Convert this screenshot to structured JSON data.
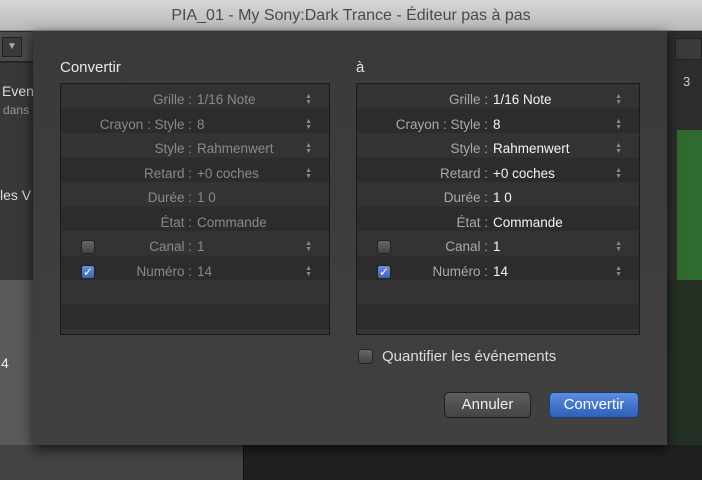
{
  "window": {
    "title": "PIA_01 - My Sony:Dark Trance - Éditeur pas à pas"
  },
  "background": {
    "dropdown_arrow": "▼",
    "event_label": "Even",
    "event_sub": "dans",
    "list_label": "les V",
    "number": "4",
    "ruler_number": "3"
  },
  "dialog": {
    "from_title": "Convertir",
    "to_title": "à",
    "from_rows": [
      {
        "label": "Grille :",
        "value": "1/16 Note",
        "stepper": true
      },
      {
        "label": "Crayon : Style :",
        "value": "8",
        "stepper": true
      },
      {
        "label": "Style :",
        "value": "Rahmenwert",
        "stepper": true
      },
      {
        "label": "Retard :",
        "value": "+0 coches",
        "stepper": true
      },
      {
        "label": "Durée :",
        "value": "1 0",
        "stepper": false
      },
      {
        "label": "État :",
        "value": "Commande",
        "stepper": false
      },
      {
        "label": "Canal :",
        "value": "1",
        "stepper": true,
        "checkbox": false
      },
      {
        "label": "Numéro :",
        "value": "14",
        "stepper": true,
        "checkbox": true
      }
    ],
    "to_rows": [
      {
        "label": "Grille :",
        "value": "1/16 Note",
        "stepper": true
      },
      {
        "label": "Crayon : Style :",
        "value": "8",
        "stepper": true
      },
      {
        "label": "Style :",
        "value": "Rahmenwert",
        "stepper": true
      },
      {
        "label": "Retard :",
        "value": "+0 coches",
        "stepper": true
      },
      {
        "label": "Durée :",
        "value": "1 0",
        "stepper": false
      },
      {
        "label": "État :",
        "value": "Commande",
        "stepper": false
      },
      {
        "label": "Canal :",
        "value": "1",
        "stepper": true,
        "checkbox": false
      },
      {
        "label": "Numéro :",
        "value": "14",
        "stepper": true,
        "checkbox": true
      }
    ],
    "quantize_label": "Quantifier les événements",
    "quantize_checked": false,
    "cancel_label": "Annuler",
    "convert_label": "Convertir",
    "accent": "#3d6cc4"
  }
}
